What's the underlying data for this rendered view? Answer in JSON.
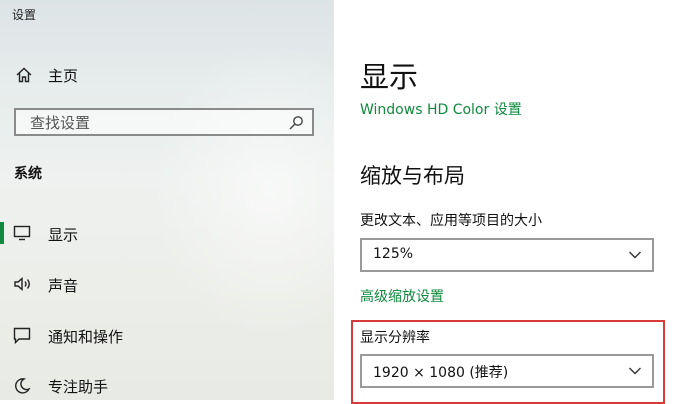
{
  "app": {
    "title": "设置"
  },
  "sidebar": {
    "home": {
      "label": "主页",
      "icon": "home-icon"
    },
    "search": {
      "placeholder": "查找设置",
      "icon": "search-icon"
    },
    "section_heading": "系统",
    "items": [
      {
        "label": "显示",
        "icon": "monitor-icon",
        "active": true
      },
      {
        "label": "声音",
        "icon": "speaker-icon",
        "active": false
      },
      {
        "label": "通知和操作",
        "icon": "notification-icon",
        "active": false
      },
      {
        "label": "专注助手",
        "icon": "moon-icon",
        "active": false
      }
    ],
    "accent_color": "#10893e"
  },
  "main": {
    "title": "显示",
    "hdr_color_link": "Windows HD Color 设置",
    "scale_section": {
      "heading": "缩放与布局",
      "scale_label": "更改文本、应用等项目的大小",
      "scale_value": "125%",
      "advanced_link": "高级缩放设置",
      "resolution_label": "显示分辨率",
      "resolution_value": "1920 × 1080 (推荐)"
    },
    "highlight_color": "#d83a3a"
  }
}
